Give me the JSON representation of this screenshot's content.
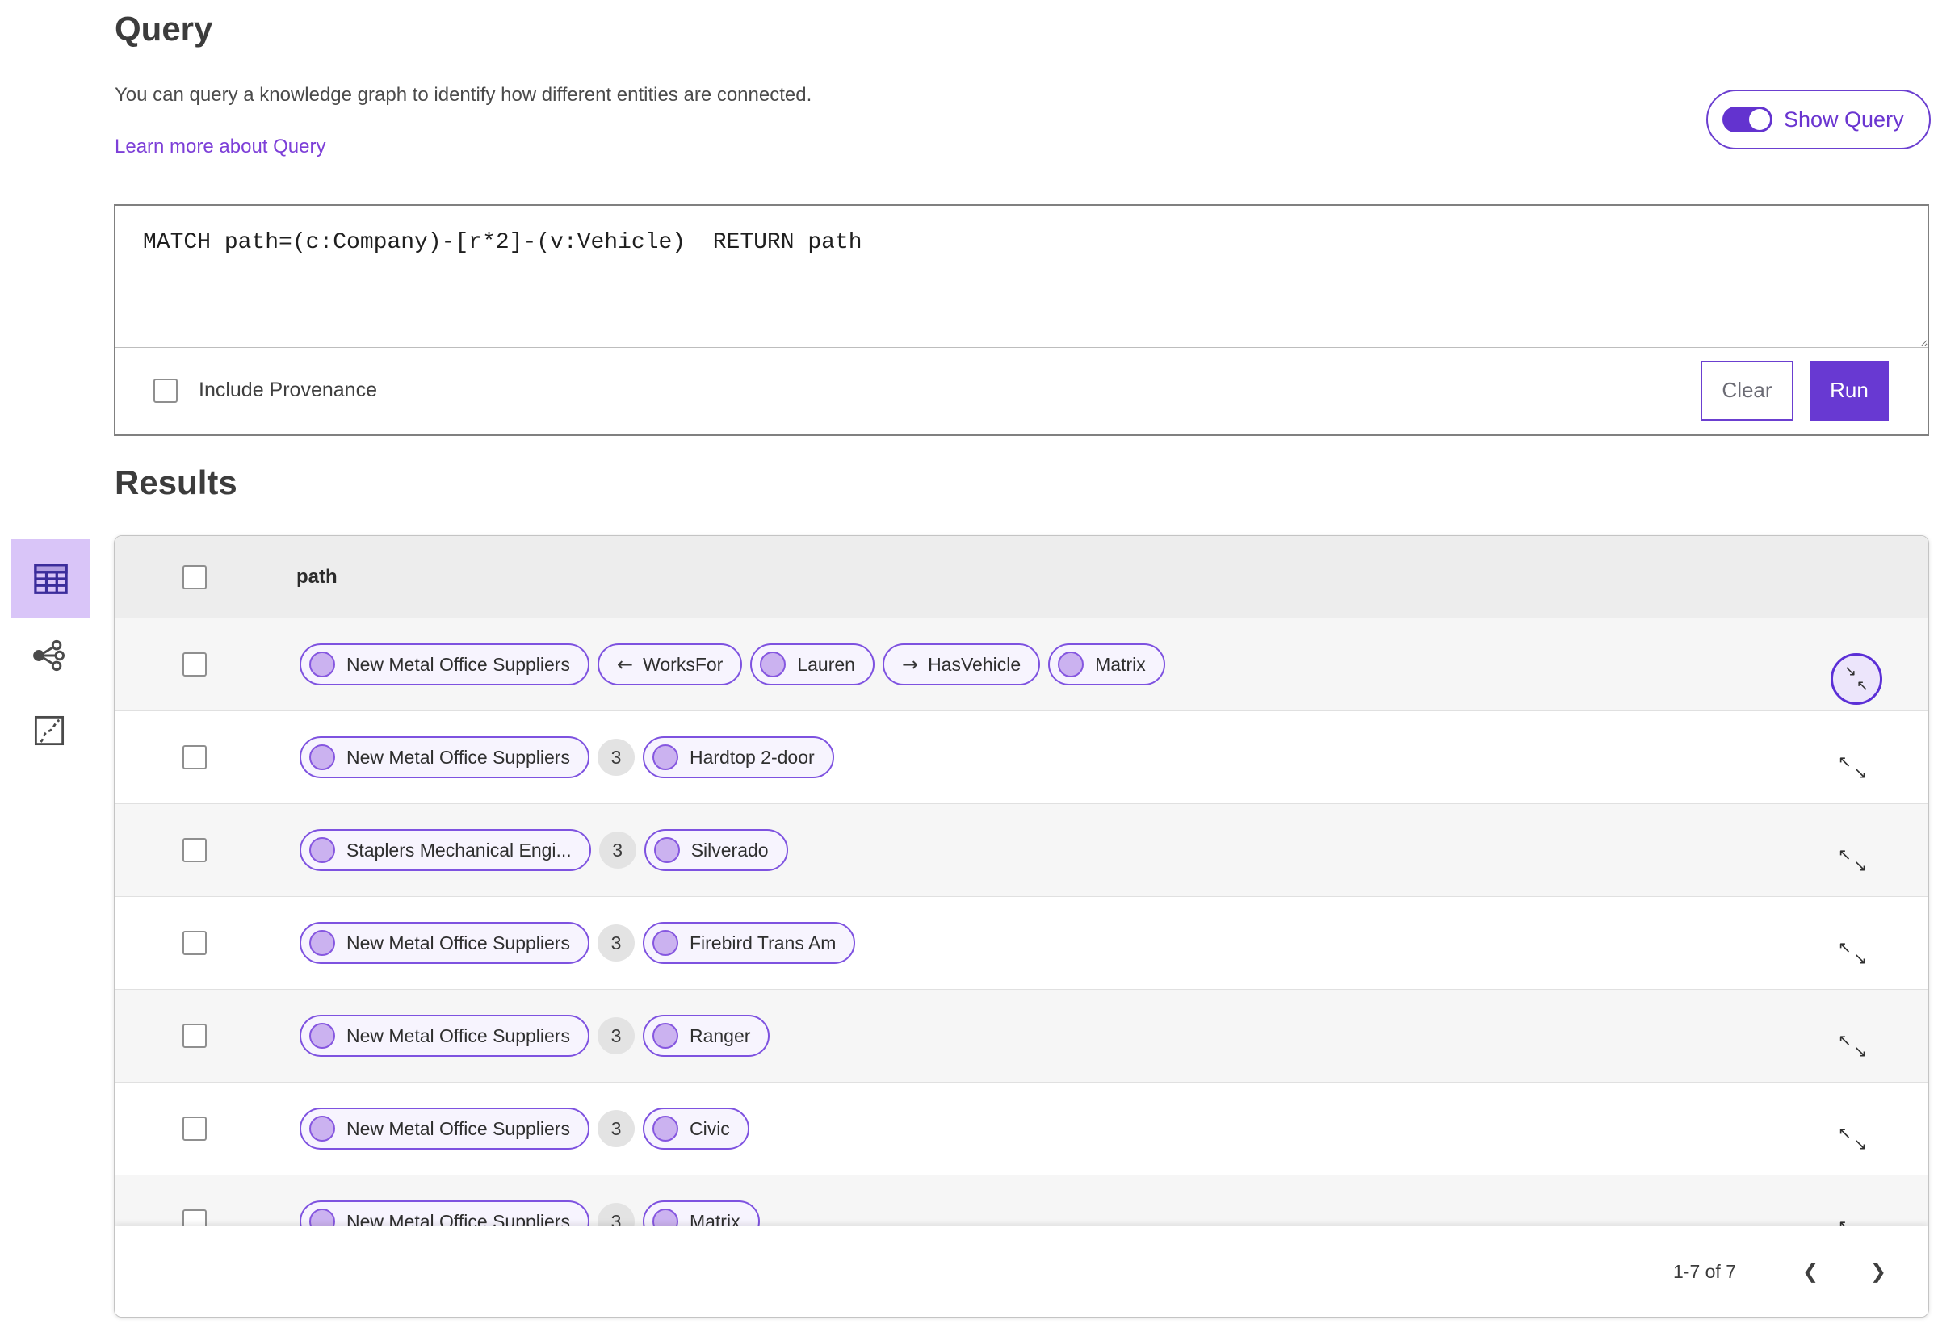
{
  "colors": {
    "accent": "#6839d2",
    "accent_outline": "#6b3fd0",
    "pill_border": "#7e52e0",
    "pill_bg": "#f7f4fe",
    "node_fill": "#cbb2f0",
    "node_stroke": "#8657e0",
    "link": "#7d3fd8",
    "selected_view_bg": "#d9c5f8",
    "header_bg": "#ededed",
    "alt_row_bg": "#f6f6f6"
  },
  "icons": {
    "arrow_left": "←",
    "arrow_right": "→",
    "expand_nw": "↖",
    "expand_se": "↘",
    "prev": "❮",
    "next": "❯"
  },
  "query": {
    "title": "Query",
    "description": "You can query a knowledge graph to identify how different entities are connected.",
    "learn_more_link": "Learn more about Query",
    "show_query_label": "Show Query",
    "show_query_on": true,
    "editor_text": "MATCH path=(c:Company)-[r*2]-(v:Vehicle)  RETURN path",
    "include_provenance_label": "Include Provenance",
    "include_provenance_checked": false,
    "clear_button": "Clear",
    "run_button": "Run"
  },
  "view_switcher": {
    "items": [
      {
        "name": "table-view",
        "selected": true
      },
      {
        "name": "graph-view",
        "selected": false
      },
      {
        "name": "map-view",
        "selected": false
      }
    ]
  },
  "results": {
    "title": "Results",
    "column_header": "path",
    "rows": [
      {
        "expander": "collapse",
        "segments": [
          {
            "type": "node",
            "label": "New Metal Office Suppliers"
          },
          {
            "type": "edge",
            "direction": "left",
            "label": "WorksFor"
          },
          {
            "type": "node",
            "label": "Lauren"
          },
          {
            "type": "edge",
            "direction": "right",
            "label": "HasVehicle"
          },
          {
            "type": "node",
            "label": "Matrix"
          }
        ]
      },
      {
        "expander": "expand",
        "segments": [
          {
            "type": "node",
            "label": "New Metal Office Suppliers"
          },
          {
            "type": "count",
            "label": "3"
          },
          {
            "type": "node",
            "label": "Hardtop 2-door"
          }
        ]
      },
      {
        "expander": "expand",
        "segments": [
          {
            "type": "node",
            "label": "Staplers Mechanical Engi..."
          },
          {
            "type": "count",
            "label": "3"
          },
          {
            "type": "node",
            "label": "Silverado"
          }
        ]
      },
      {
        "expander": "expand",
        "segments": [
          {
            "type": "node",
            "label": "New Metal Office Suppliers"
          },
          {
            "type": "count",
            "label": "3"
          },
          {
            "type": "node",
            "label": "Firebird Trans Am"
          }
        ]
      },
      {
        "expander": "expand",
        "segments": [
          {
            "type": "node",
            "label": "New Metal Office Suppliers"
          },
          {
            "type": "count",
            "label": "3"
          },
          {
            "type": "node",
            "label": "Ranger"
          }
        ]
      },
      {
        "expander": "expand",
        "segments": [
          {
            "type": "node",
            "label": "New Metal Office Suppliers"
          },
          {
            "type": "count",
            "label": "3"
          },
          {
            "type": "node",
            "label": "Civic"
          }
        ]
      },
      {
        "expander": "expand",
        "segments": [
          {
            "type": "node",
            "label": "New Metal Office Suppliers"
          },
          {
            "type": "count",
            "label": "3"
          },
          {
            "type": "node",
            "label": "Matrix"
          }
        ]
      }
    ],
    "pagination": {
      "range_label": "1-7 of 7"
    }
  }
}
